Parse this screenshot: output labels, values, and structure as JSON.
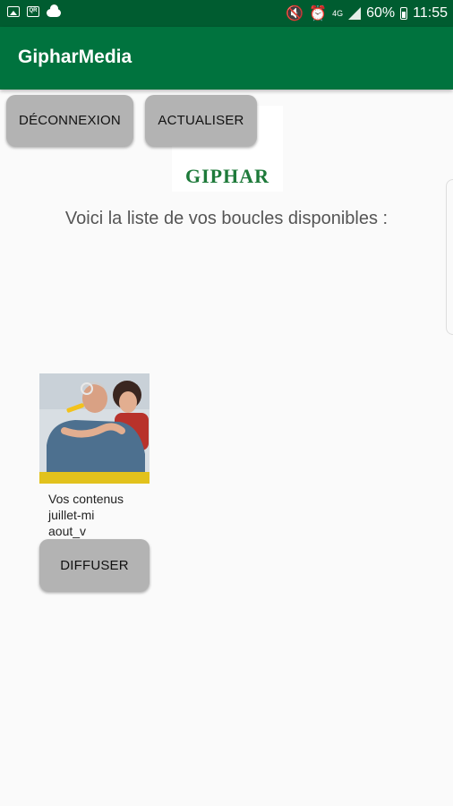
{
  "status_bar": {
    "icons_left": [
      "gallery-icon",
      "qr-icon",
      "cloud-icon"
    ],
    "icons_right": [
      "mute-icon",
      "alarm-icon",
      "signal-icon",
      "battery-icon"
    ],
    "network": "4G",
    "battery": "60%",
    "time": "11:55"
  },
  "app_bar": {
    "title": "GipharMedia"
  },
  "actions": {
    "logout_label": "DÉCONNEXION",
    "refresh_label": "ACTUALISER"
  },
  "logo": {
    "text": "GIPHAR"
  },
  "intro_text": "Voici la liste de vos boucles disponibles :",
  "items": [
    {
      "label": "Vos contenus\njuillet-mi\naout_v",
      "action_label": "DIFFUSER"
    }
  ],
  "colors": {
    "status_bar": "#005c30",
    "app_bar": "#00733e",
    "button": "#b3b3b3",
    "background": "#fafafa"
  }
}
